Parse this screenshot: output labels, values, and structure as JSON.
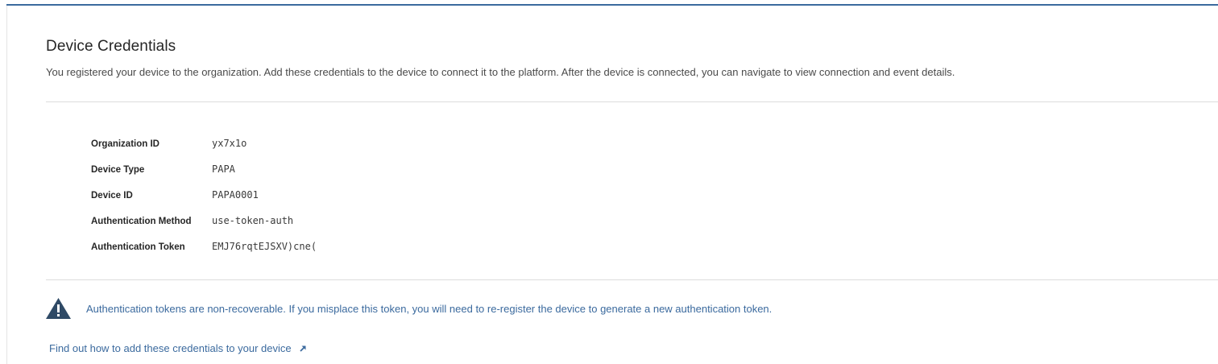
{
  "section": {
    "title": "Device Credentials",
    "description": "You registered your device to the organization. Add these credentials to the device to connect it to the platform. After the device is connected, you can navigate to view connection and event details."
  },
  "credentials": [
    {
      "label": "Organization ID",
      "value": "yx7x1o"
    },
    {
      "label": "Device Type",
      "value": "PAPA"
    },
    {
      "label": "Device ID",
      "value": "PAPA0001"
    },
    {
      "label": "Authentication Method",
      "value": "use-token-auth"
    },
    {
      "label": "Authentication Token",
      "value": "EMJ76rqtEJSXV)cne("
    }
  ],
  "warning": {
    "icon": "warning-triangle-icon",
    "text": "Authentication tokens are non-recoverable. If you misplace this token, you will need to re-register the device to generate a new authentication token."
  },
  "help_link": {
    "label": "Find out how to add these credentials to your device",
    "icon": "external-link-arrow-icon"
  },
  "colors": {
    "accent": "#3b6a9e",
    "warning_icon": "#2f4a66",
    "text_primary": "#262626",
    "divider": "#dcdcdc"
  }
}
